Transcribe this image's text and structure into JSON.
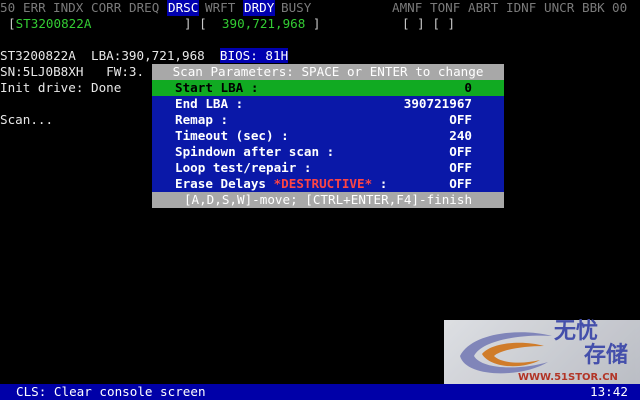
{
  "header": {
    "flags": [
      {
        "label": "50",
        "active": false
      },
      {
        "label": "ERR",
        "active": false
      },
      {
        "label": "INDX",
        "active": false
      },
      {
        "label": "CORR",
        "active": false
      },
      {
        "label": "DREQ",
        "active": false
      },
      {
        "label": "DRSC",
        "active": true
      },
      {
        "label": "WRFT",
        "active": false
      },
      {
        "label": "DRDY",
        "active": true
      },
      {
        "label": "BUSY",
        "active": false
      }
    ],
    "right_flags": [
      "AMNF",
      "TONF",
      "ABRT",
      "IDNF",
      "UNCR",
      "BBK",
      "00"
    ],
    "model_field": "ST3200822A",
    "lba_field": "390,721,968",
    "bracket_open": "[",
    "bracket_mid": "] [",
    "bracket_close": "]",
    "right_brackets": "[ ] [ ]"
  },
  "console": {
    "line1_model": "ST3200822A",
    "line1_lba": "LBA:390,721,968",
    "line1_bios": "BIOS: 81H",
    "line2_sn": "SN:5LJ0B8XH",
    "line2_fw": "FW:3.",
    "line3": "Init drive: Done",
    "line4": "Scan..."
  },
  "dialog": {
    "title": "Scan Parameters: SPACE or ENTER to change",
    "rows": [
      {
        "label": "Start LBA :",
        "value": "0",
        "selected": true
      },
      {
        "label": "End LBA :",
        "value": "390721967",
        "selected": false
      },
      {
        "label": "Remap :",
        "value": "OFF",
        "selected": false
      },
      {
        "label": "Timeout (sec) :",
        "value": "240",
        "selected": false
      },
      {
        "label": "Spindown after scan :",
        "value": "OFF",
        "selected": false
      },
      {
        "label": "Loop test/repair :",
        "value": "OFF",
        "selected": false
      }
    ],
    "erase": {
      "label": "Erase Delays ",
      "warn": "*DESTRUCTIVE*",
      "label_tail": " :",
      "value": "OFF"
    },
    "footer": "[A,D,S,W]-move; [CTRL+ENTER,F4]-finish"
  },
  "statusbar": {
    "message": "CLS: Clear console screen",
    "clock": "13:42"
  },
  "watermark": {
    "chars1": "无忧",
    "chars2": "存储",
    "url": "WWW.51STOR.CN"
  },
  "colors": {
    "background": "#000000",
    "dialog_bg": "#0a18a8",
    "selected_row": "#11aa22",
    "status_bar": "#0000a8",
    "destructive": "#ff4444",
    "field_green": "#33cc33"
  }
}
